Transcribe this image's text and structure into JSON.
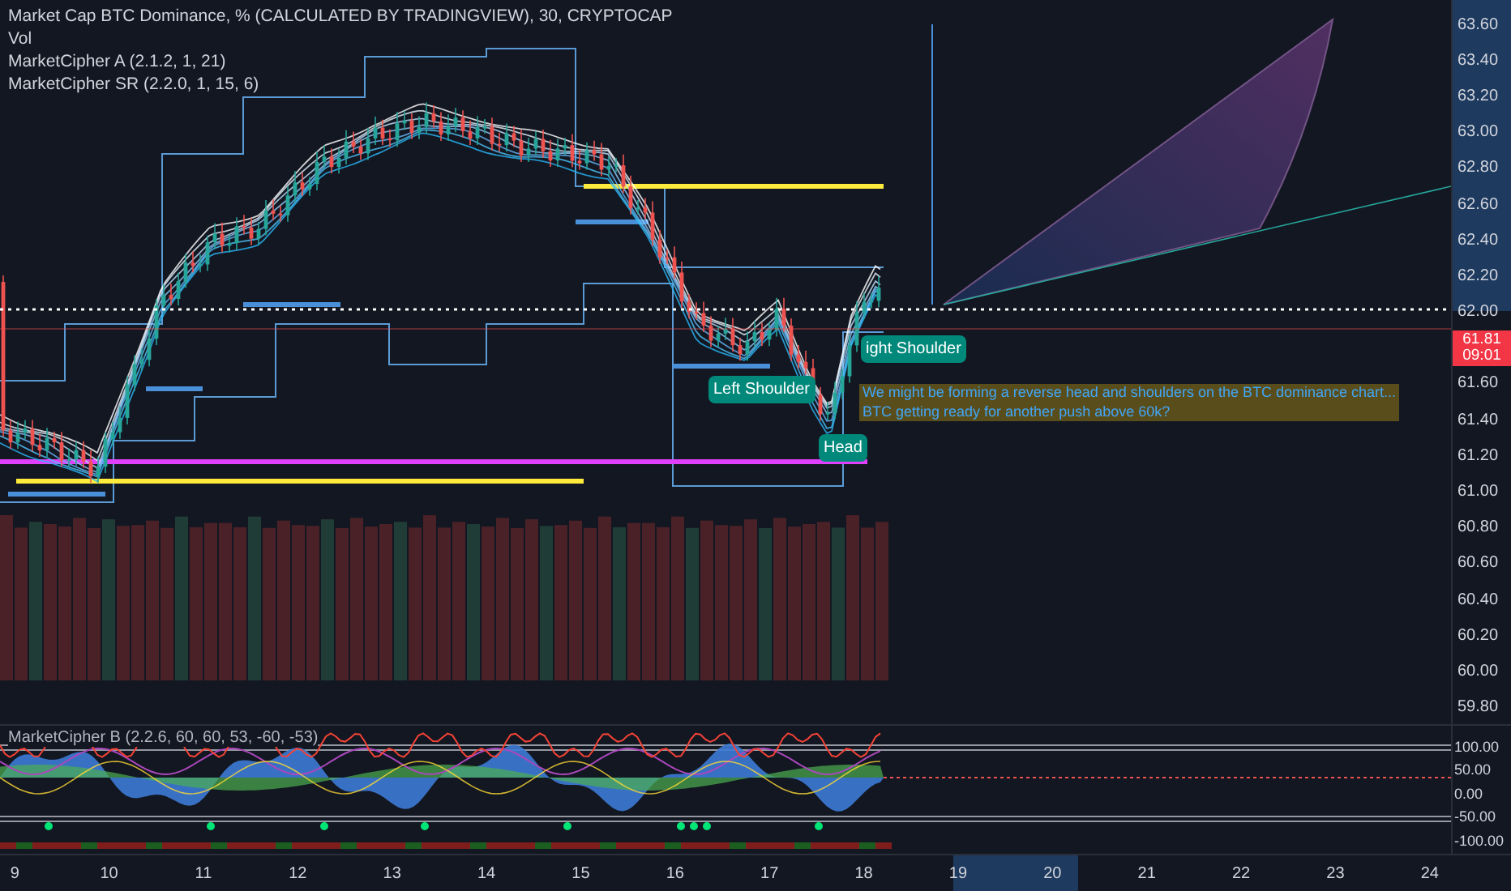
{
  "legend": {
    "title": "Market Cap BTC Dominance, % (CALCULATED BY TRADINGVIEW), 30, CRYPTOCAP",
    "indicators": [
      "Vol",
      "MarketCipher A (2.1.2, 1, 21)",
      "MarketCipher SR (2.2.0, 1, 15, 6)"
    ]
  },
  "annotations": [
    {
      "kind": "label",
      "text": "Left Shoulder"
    },
    {
      "kind": "label",
      "text": "Head"
    },
    {
      "kind": "label",
      "text": "ight Shoulder"
    },
    {
      "kind": "note",
      "lines": [
        "We might be forming a reverse head and shoulders on the BTC dominance chart...",
        "BTC getting ready for another push above 60k?"
      ]
    }
  ],
  "price_axis": {
    "upper": [
      "63.60",
      "63.40",
      "63.20",
      "63.00",
      "62.80",
      "62.60",
      "62.40",
      "62.20",
      "62.00"
    ],
    "lower": [
      "61.60",
      "61.40",
      "61.20",
      "61.00",
      "60.80",
      "60.60",
      "60.40",
      "60.20",
      "60.00",
      "59.80"
    ]
  },
  "current_price": {
    "value": "61.81",
    "countdown": "09:01"
  },
  "oscillator": {
    "legend": "MarketCipher B (2.2.6, 60, 60, 53, -60, -53)",
    "axis": [
      "100.00",
      "50.00",
      "0.00",
      "-50.00",
      "-100.00"
    ]
  },
  "time_axis": [
    "9",
    "10",
    "11",
    "12",
    "13",
    "14",
    "15",
    "16",
    "17",
    "18",
    "19",
    "20",
    "21",
    "22",
    "23",
    "24"
  ]
}
